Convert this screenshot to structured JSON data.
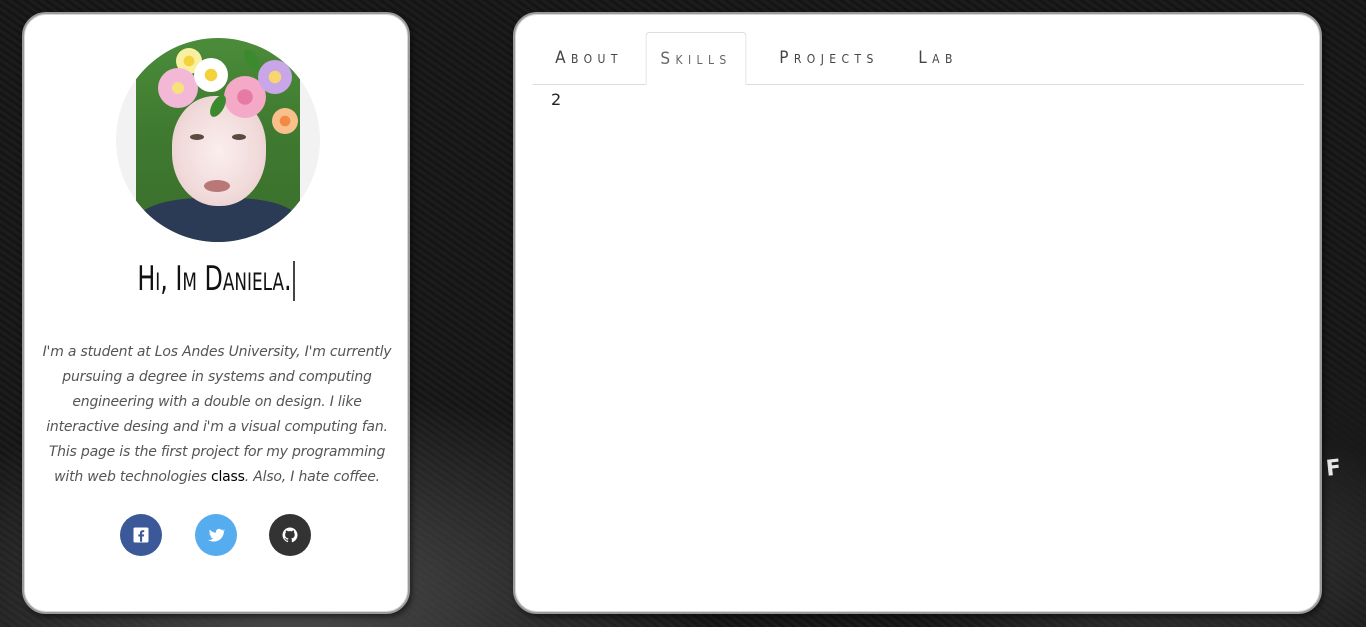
{
  "profile": {
    "greeting": "Hi, Im Daniela.",
    "bio_before": "I'm a student at Los Andes University, I'm currently pursuing a degree in systems and computing engineering with a double on design. I like interactive desing and i'm a visual computing fan. This page is the first project for my programming with web technologies ",
    "bio_highlight": "class",
    "bio_after": ". Also, I hate coffee.",
    "socials": [
      {
        "name": "facebook",
        "icon": "facebook-icon",
        "color": "#3b5998"
      },
      {
        "name": "twitter",
        "icon": "twitter-icon",
        "color": "#55acee"
      },
      {
        "name": "github",
        "icon": "github-icon",
        "color": "#333333"
      }
    ]
  },
  "tabs": {
    "about": "About",
    "skills": "Skills",
    "projects": "Projects",
    "lab": "Lab",
    "active": "Skills"
  },
  "panel": {
    "content": "2"
  },
  "background": {
    "text": "F"
  }
}
